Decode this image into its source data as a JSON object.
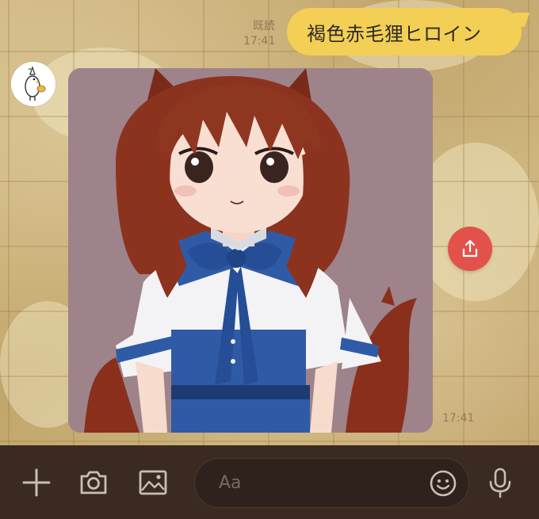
{
  "chat": {
    "sent_message": "褐色赤毛狸ヒロイン",
    "sent_read_label": "既読",
    "sent_time": "17:41",
    "received_image_time": "17:41",
    "received_image_alt": "anime girl with auburn hair, fox ears and tail, blue sailor uniform"
  },
  "input_bar": {
    "placeholder": "Aa",
    "icons": [
      "plus-icon",
      "camera-icon",
      "image-icon",
      "emoji-icon",
      "microphone-icon"
    ]
  },
  "colors": {
    "sent_bubble": "#f4cf55",
    "share_button": "#e3524a",
    "input_bar_bg": "#3a2a22"
  }
}
